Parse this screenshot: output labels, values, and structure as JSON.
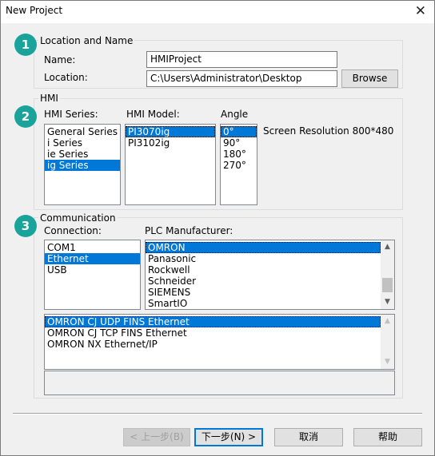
{
  "window": {
    "title": "New Project",
    "close_glyph": "✕"
  },
  "location_group": {
    "badge": "1",
    "label": "Location and Name",
    "name_label": "Name:",
    "name_value": "HMIProject",
    "location_label": "Location:",
    "location_value": "C:\\Users\\Administrator\\Desktop",
    "browse_label": "Browse"
  },
  "hmi_group": {
    "badge": "2",
    "label": "HMI",
    "series_label": "HMI Series:",
    "series_items": [
      "General Series",
      "i Series",
      "ie Series",
      "ig Series"
    ],
    "series_selected": "ig Series",
    "model_label": "HMI Model:",
    "model_items": [
      "PI3070ig",
      "PI3102ig"
    ],
    "model_selected": "PI3070ig",
    "angle_label": "Angle",
    "angle_items": [
      "0°",
      "90°",
      "180°",
      "270°"
    ],
    "angle_selected": "0°",
    "resolution_text": "Screen Resolution 800*480"
  },
  "comm_group": {
    "badge": "3",
    "label": "Communication",
    "connection_label": "Connection:",
    "connection_items": [
      "COM1",
      "Ethernet",
      "USB"
    ],
    "connection_selected": "Ethernet",
    "plc_label": "PLC Manufacturer:",
    "plc_items": [
      "OMRON",
      "Panasonic",
      "Rockwell",
      "Schneider",
      "SIEMENS",
      "SmartIO"
    ],
    "plc_selected": "OMRON",
    "driver_items": [
      "OMRON CJ UDP FINS Ethernet",
      "OMRON CJ TCP FINS Ethernet",
      "OMRON NX Ethernet/IP"
    ],
    "driver_selected": "OMRON CJ UDP FINS Ethernet"
  },
  "buttons": {
    "back": "< 上一步(B)",
    "next": "下一步(N) >",
    "cancel": "取消",
    "help": "帮助"
  }
}
